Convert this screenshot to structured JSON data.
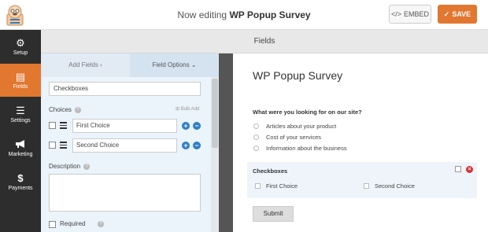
{
  "header": {
    "title_prefix": "Now editing",
    "title_form": "WP Popup Survey",
    "embed_label": "EMBED",
    "embed_icon": "</>",
    "save_label": "SAVE"
  },
  "sidebar": {
    "items": [
      {
        "label": "Setup",
        "icon": "gear-icon",
        "glyph": "⚙"
      },
      {
        "label": "Fields",
        "icon": "fields-icon",
        "glyph": "▤"
      },
      {
        "label": "Settings",
        "icon": "sliders-icon",
        "glyph": "☰"
      },
      {
        "label": "Marketing",
        "icon": "megaphone-icon",
        "glyph": "📢"
      },
      {
        "label": "Payments",
        "icon": "dollar-icon",
        "glyph": "$"
      }
    ]
  },
  "fields_bar": {
    "title": "Fields"
  },
  "panel": {
    "tabs": {
      "add_fields": "Add Fields ›",
      "field_options": "Field Options ⌄"
    },
    "field_label_value": "Checkboxes",
    "choices_label": "Choices",
    "bulk_add": "Bulk Add",
    "choices": [
      {
        "value": "First Choice"
      },
      {
        "value": "Second Choice"
      }
    ],
    "description_label": "Description",
    "required_label": "Required"
  },
  "preview": {
    "form_title": "WP Popup Survey",
    "question_label": "What were you looking for on our site?",
    "radio_options": [
      "Articles about your product",
      "Cost of your services",
      "Information about the business"
    ],
    "checkbox_label": "Checkboxes",
    "checkbox_options": [
      "First Choice",
      "Second Choice"
    ],
    "submit_label": "Submit"
  },
  "colors": {
    "accent": "#e27730",
    "sidebar_bg": "#2d2d2d",
    "link_blue": "#2c7ec5"
  }
}
